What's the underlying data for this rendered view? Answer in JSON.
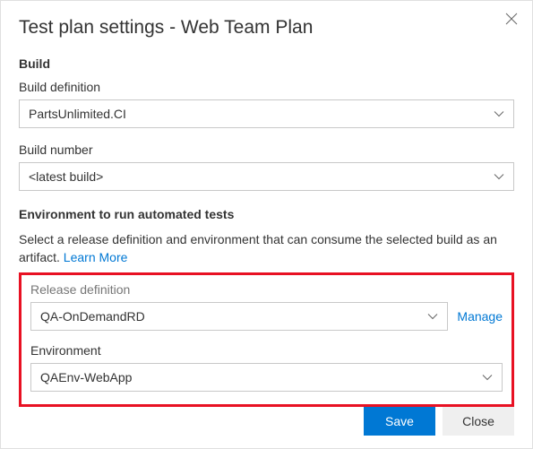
{
  "dialog": {
    "title": "Test plan settings - Web Team Plan"
  },
  "build": {
    "header": "Build",
    "definition_label": "Build definition",
    "definition_value": "PartsUnlimited.CI",
    "number_label": "Build number",
    "number_value": "<latest build>"
  },
  "environment": {
    "header": "Environment to run automated tests",
    "description": "Select a release definition and environment that can consume the selected build as an artifact.  ",
    "learn_more": "Learn More",
    "release_def_label": "Release definition",
    "release_def_value": "QA-OnDemandRD",
    "manage_link": "Manage",
    "env_label": "Environment",
    "env_value": "QAEnv-WebApp"
  },
  "footer": {
    "save": "Save",
    "close": "Close"
  }
}
